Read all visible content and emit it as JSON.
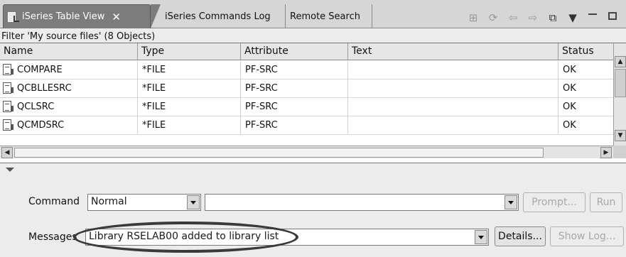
{
  "tabs": [
    {
      "label": "iSeries Table View",
      "active": true
    },
    {
      "label": "iSeries Commands Log",
      "active": false
    },
    {
      "label": "Remote Search",
      "active": false
    }
  ],
  "tab_close": "✕",
  "toolbar_icons": [
    "show-in-table-icon",
    "refresh-icon",
    "back-icon",
    "forward-icon",
    "up-folder-icon",
    "view-menu-icon",
    "minimize-icon",
    "maximize-icon"
  ],
  "filter_label": "Filter 'My source files' (8 Objects)",
  "table": {
    "columns": [
      "Name",
      "Type",
      "Attribute",
      "Text",
      "Status"
    ],
    "rows": [
      {
        "name": "COMPARE",
        "type": "*FILE",
        "attribute": "PF-SRC",
        "text": "",
        "status": "OK"
      },
      {
        "name": "QCBLLESRC",
        "type": "*FILE",
        "attribute": "PF-SRC",
        "text": "",
        "status": "OK"
      },
      {
        "name": "QCLSRC",
        "type": "*FILE",
        "attribute": "PF-SRC",
        "text": "",
        "status": "OK"
      },
      {
        "name": "QCMDSRC",
        "type": "*FILE",
        "attribute": "PF-SRC",
        "text": "",
        "status": "OK"
      }
    ]
  },
  "command": {
    "label": "Command",
    "mode_value": "Normal",
    "command_value": "",
    "prompt_label": "Prompt...",
    "run_label": "Run"
  },
  "messages": {
    "label": "Messages",
    "value": "Library RSELAB00 added to library list",
    "details_label": "Details...",
    "showlog_label": "Show Log..."
  },
  "colors": {
    "active_tab": "#7c7c7c",
    "highlight_ellipse": "#3a3a3a"
  }
}
